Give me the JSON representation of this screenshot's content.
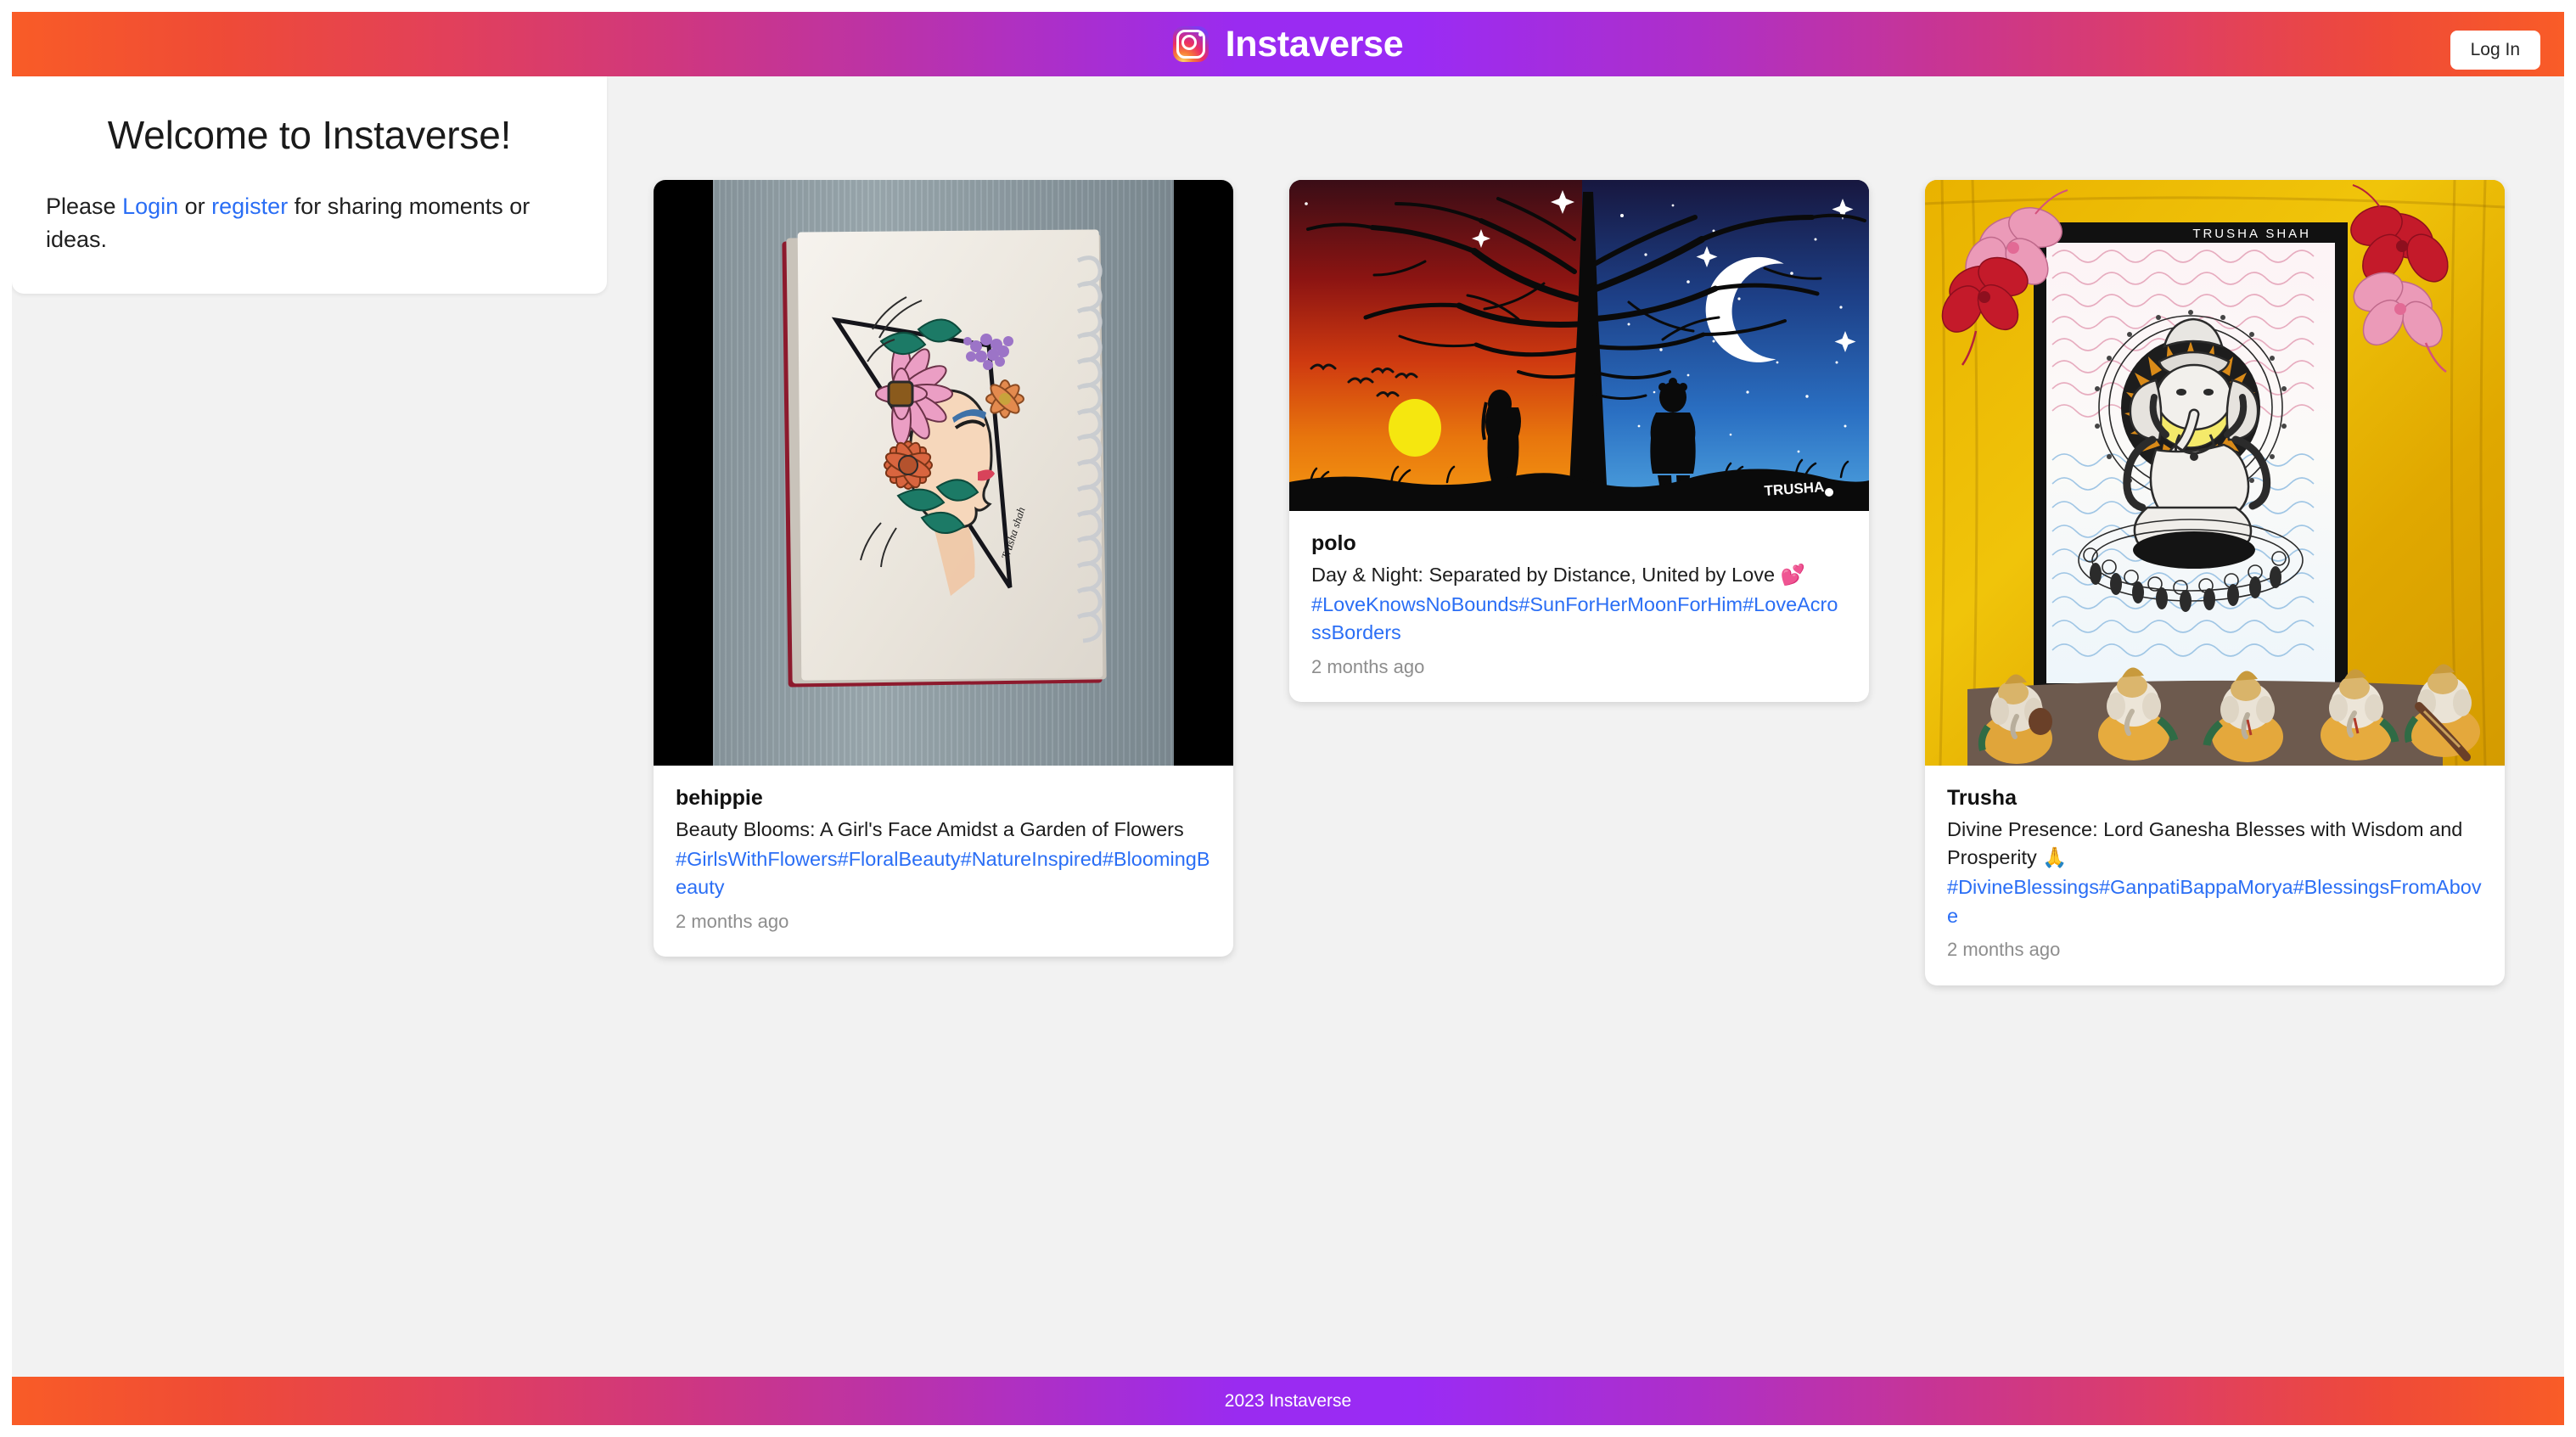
{
  "header": {
    "logo_icon": "instagram-icon",
    "title": "Instaverse",
    "login_button": "Log In"
  },
  "welcome": {
    "heading": "Welcome to Instaverse!",
    "text_before": "Please ",
    "login_link": "Login",
    "text_middle": " or ",
    "register_link": "register",
    "text_after": " for sharing moments or ideas."
  },
  "posts": [
    {
      "username": "behippie",
      "caption": "Beauty Blooms: A Girl's Face Amidst a Garden of Flowers",
      "hashtags": "#GirlsWithFlowers#FloralBeauty#NatureInspired#BloomingBeauty",
      "time": "2 months ago",
      "image_alt": "Spiral sketchbook on grey wood with a pencil drawing of a girl's profile crowned with pink, orange and purple flowers",
      "artist_signature": "Trusha shah"
    },
    {
      "username": "polo",
      "caption": "Day & Night: Separated by Distance, United by Love 💕",
      "hashtags": "#LoveKnowsNoBounds#SunForHerMoonForHim#LoveAcrossBorders",
      "time": "2 months ago",
      "image_alt": "Split illustration of a sunset day side with a girl silhouette and a starry night side with a boy silhouette, bare tree in the middle",
      "artist_signature": "TRUSHA"
    },
    {
      "username": "Trusha",
      "caption": "Divine Presence: Lord Ganesha Blesses with Wisdom and Prosperity 🙏",
      "hashtags": "#DivineBlessings#GanpatiBappaMorya#BlessingsFromAbove",
      "time": "2 months ago",
      "image_alt": "Framed black-and-white mandala drawing of Lord Ganesha on yellow fabric with hibiscus flowers and five Ganesha figurines",
      "artwork_label": "TRUSHA SHAH"
    }
  ],
  "footer": {
    "text": "2023 Instaverse"
  },
  "colors": {
    "gradient_orange": "#f95c27",
    "gradient_pink": "#cf377f",
    "gradient_purple": "#9a2bf5",
    "link_blue": "#2a6ef5",
    "page_background": "#f2f2f2",
    "card_background": "#ffffff",
    "muted_text": "#8d8d8d"
  }
}
